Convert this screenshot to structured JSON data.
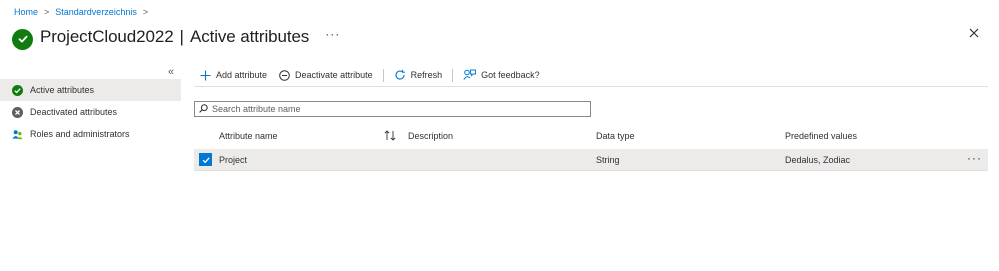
{
  "breadcrumb": {
    "home": "Home",
    "parent": "Standardverzeichnis",
    "separator": ">"
  },
  "header": {
    "title_main": "ProjectCloud2022",
    "separator": "|",
    "title_sub": "Active attributes",
    "more": "···"
  },
  "sidebar": {
    "collapse": "«",
    "items": [
      {
        "label": "Active attributes",
        "icon": "check-circle-icon",
        "active": true
      },
      {
        "label": "Deactivated attributes",
        "icon": "x-circle-icon",
        "active": false
      },
      {
        "label": "Roles and administrators",
        "icon": "people-icon",
        "active": false
      }
    ]
  },
  "toolbar": {
    "add": "Add attribute",
    "deactivate": "Deactivate attribute",
    "refresh": "Refresh",
    "feedback": "Got feedback?"
  },
  "search": {
    "placeholder": "Search attribute name",
    "value": ""
  },
  "table": {
    "columns": [
      "Attribute name",
      "Description",
      "Data type",
      "Predefined values"
    ],
    "rows": [
      {
        "selected": true,
        "attribute_name": "Project",
        "description": "",
        "data_type": "String",
        "predefined_values": "Dedalus, Zodiac",
        "more": "···"
      }
    ]
  },
  "colors": {
    "accent": "#0078d4",
    "success": "#107c10",
    "selected_bg": "#edebe9"
  }
}
